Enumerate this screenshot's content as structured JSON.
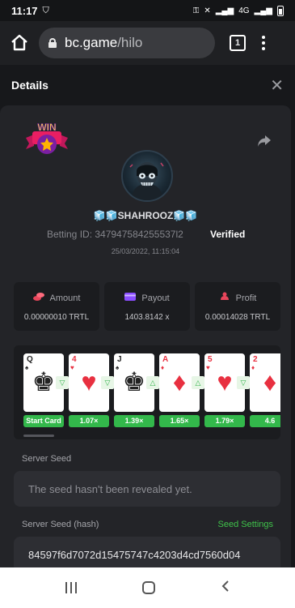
{
  "status": {
    "time": "11:17",
    "network": "4G"
  },
  "browser": {
    "domain": "bc.game",
    "path": "/hilo",
    "tab_count": "1"
  },
  "header": {
    "title": "Details",
    "close": "✕"
  },
  "user": {
    "name": "🧊🧊SHAHROOZ🧊🧊",
    "betting_id": "Betting ID: 347947584255537l2",
    "verified": "Verified",
    "date": "25/03/2022, 11:15:04"
  },
  "stats": [
    {
      "label": "Amount",
      "value": "0.00000010 TRTL",
      "color": "#e8465b"
    },
    {
      "label": "Payout",
      "value": "1403.8142 x",
      "color": "#8a4dff"
    },
    {
      "label": "Profit",
      "value": "0.00014028 TRTL",
      "color": "#e8465b"
    }
  ],
  "cards": [
    {
      "rank": "Q",
      "suit": "♠",
      "color": "#222",
      "big": "♚",
      "badge": "Start Card",
      "dir": "▽"
    },
    {
      "rank": "4",
      "suit": "♥",
      "color": "#e83040",
      "big": "♥",
      "badge": "1.07×",
      "dir": "▽"
    },
    {
      "rank": "J",
      "suit": "♠",
      "color": "#222",
      "big": "♚",
      "badge": "1.39×",
      "dir": "△"
    },
    {
      "rank": "A",
      "suit": "♦",
      "color": "#e83040",
      "big": "♦",
      "badge": "1.65×",
      "dir": "△"
    },
    {
      "rank": "5",
      "suit": "♥",
      "color": "#e83040",
      "big": "♥",
      "badge": "1.79×",
      "dir": "▽"
    },
    {
      "rank": "2",
      "suit": "♦",
      "color": "#e83040",
      "big": "♦",
      "badge": "4.6",
      "dir": "▽"
    }
  ],
  "seed": {
    "server_label": "Server Seed",
    "server_value": "The seed hasn't been revealed yet.",
    "hash_label": "Server Seed (hash)",
    "settings": "Seed Settings",
    "hash_value": "84597f6d7072d15475747c4203d4cd7560d04"
  },
  "colors": {
    "accent": "#3fc24a",
    "panel": "#232428"
  }
}
